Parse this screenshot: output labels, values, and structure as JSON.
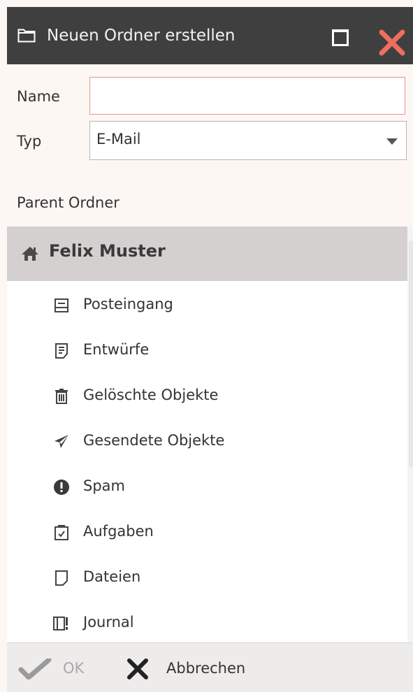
{
  "dialog": {
    "title": "Neuen Ordner erstellen",
    "title_icon": "folder-icon",
    "buttons": {
      "maximize": "maximize-icon",
      "close": "close-icon"
    }
  },
  "form": {
    "name_label": "Name",
    "name_value": "",
    "type_label": "Typ",
    "type_value": "E-Mail",
    "parent_label": "Parent Ordner"
  },
  "tree": {
    "root": {
      "label": "Felix Muster",
      "icon": "home-icon"
    },
    "items": [
      {
        "label": "Posteingang",
        "icon": "inbox-icon"
      },
      {
        "label": "Entwürfe",
        "icon": "drafts-icon"
      },
      {
        "label": "Gelöschte Objekte",
        "icon": "trash-icon"
      },
      {
        "label": "Gesendete Objekte",
        "icon": "send-icon"
      },
      {
        "label": "Spam",
        "icon": "exclamation-icon"
      },
      {
        "label": "Aufgaben",
        "icon": "tasks-icon"
      },
      {
        "label": "Dateien",
        "icon": "file-icon"
      },
      {
        "label": "Journal",
        "icon": "journal-icon"
      }
    ]
  },
  "footer": {
    "ok_label": "OK",
    "cancel_label": "Abbrechen"
  },
  "colors": {
    "titlebar": "#3f3f3f",
    "close": "#ef6e5f",
    "selected_row": "#d3d0cf",
    "invalid_border": "#e39595"
  }
}
